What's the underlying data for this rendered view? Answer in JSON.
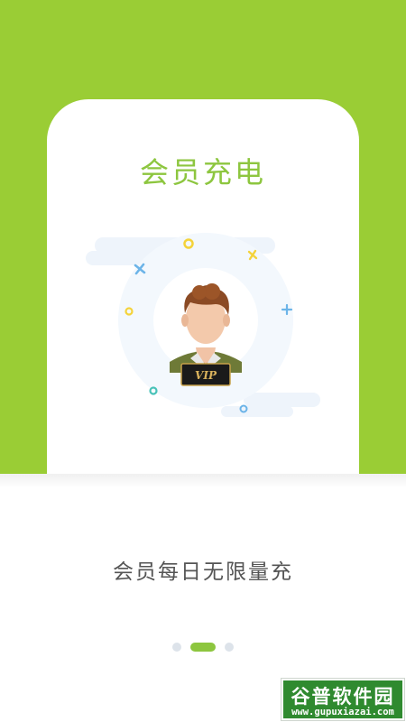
{
  "card": {
    "title": "会员充电",
    "badge_text": "VIP"
  },
  "subtitle": "会员每日无限量充",
  "pager": {
    "page_count": 3,
    "current_page": 2
  },
  "watermark": {
    "brand": "谷普软件园",
    "url": "www.gupuxiazai.com"
  },
  "colors": {
    "accent_green": "#9acd35",
    "title_green": "#8dc63f",
    "dot_inactive": "#dde3ea"
  }
}
